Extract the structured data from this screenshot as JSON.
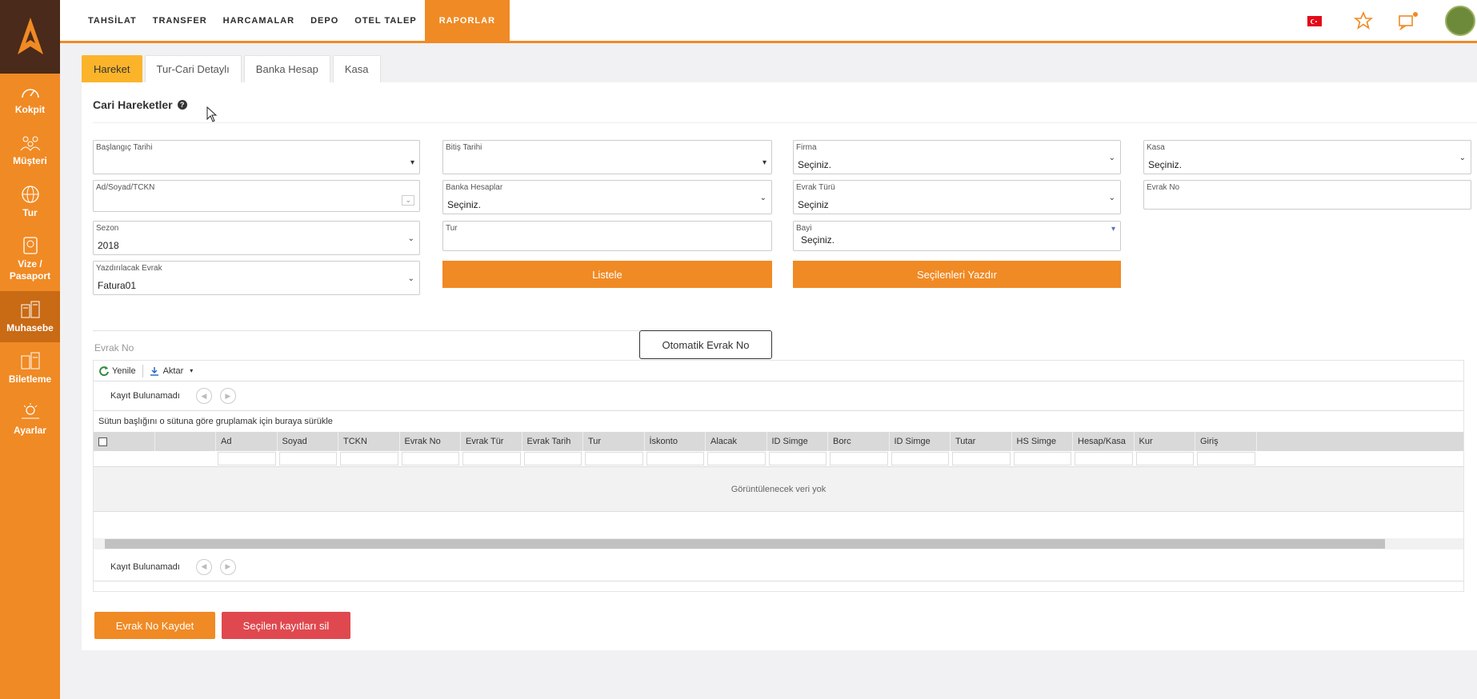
{
  "sidebar": {
    "items": [
      {
        "label": "Kokpit",
        "icon": "dashboard-icon"
      },
      {
        "label": "Müşteri",
        "icon": "customers-icon"
      },
      {
        "label": "Tur",
        "icon": "globe-icon"
      },
      {
        "label": "Vize / Pasaport",
        "icon": "passport-icon"
      },
      {
        "label": "Muhasebe",
        "icon": "accounting-icon"
      },
      {
        "label": "Biletleme",
        "icon": "ticket-icon"
      },
      {
        "label": "Ayarlar",
        "icon": "settings-icon"
      }
    ],
    "active": "Muhasebe"
  },
  "topnav": {
    "items": [
      "TAHSİLAT",
      "TRANSFER",
      "HARCAMALAR",
      "DEPO",
      "OTEL TALEP",
      "RAPORLAR"
    ],
    "active": "RAPORLAR"
  },
  "tabs": [
    "Hareket",
    "Tur-Cari Detaylı",
    "Banka Hesap",
    "Kasa"
  ],
  "panel": {
    "title": "Cari Hareketler"
  },
  "form": {
    "baslangic": {
      "label": "Başlangıç Tarihi",
      "value": ""
    },
    "bitis": {
      "label": "Bitiş Tarihi",
      "value": ""
    },
    "firma": {
      "label": "Firma",
      "value": "Seçiniz."
    },
    "kasa": {
      "label": "Kasa",
      "value": "Seçiniz."
    },
    "adsoyad": {
      "label": "Ad/Soyad/TCKN",
      "value": ""
    },
    "banka": {
      "label": "Banka Hesaplar",
      "value": "Seçiniz."
    },
    "evrakturu": {
      "label": "Evrak Türü",
      "value": "Seçiniz"
    },
    "evrakno": {
      "label": "Evrak No",
      "value": ""
    },
    "sezon": {
      "label": "Sezon",
      "value": "2018"
    },
    "tur": {
      "label": "Tur",
      "value": ""
    },
    "bayi": {
      "label": "Bayi",
      "value": "Seçiniz."
    },
    "yazdirilacak": {
      "label": "Yazdırılacak Evrak",
      "value": "Fatura01"
    }
  },
  "buttons": {
    "listele": "Listele",
    "yazdir": "Seçilenleri Yazdır",
    "otomatik": "Otomatik Evrak No",
    "kaydet": "Evrak No Kaydet",
    "sil": "Seçilen kayıtları sil"
  },
  "evrak_no_placeholder": "Evrak No",
  "grid": {
    "refresh": "Yenile",
    "export": "Aktar",
    "pager_text": "Kayıt Bulunamadı",
    "group_hint": "Sütun başlığını o sütuna göre gruplamak için buraya sürükle",
    "columns": [
      "",
      "",
      "Ad",
      "Soyad",
      "TCKN",
      "Evrak No",
      "Evrak Tür",
      "Evrak Tarih",
      "Tur",
      "İskonto",
      "Alacak",
      "ID Simge",
      "Borc",
      "ID Simge",
      "Tutar",
      "HS Simge",
      "Hesap/Kasa",
      "Kur",
      "Giriş"
    ],
    "empty": "Görüntülenecek veri yok"
  },
  "colors": {
    "accent": "#f08a24",
    "tab_active": "#fbb42a",
    "danger": "#e0484f",
    "logo_bg": "#4a2a1a"
  }
}
